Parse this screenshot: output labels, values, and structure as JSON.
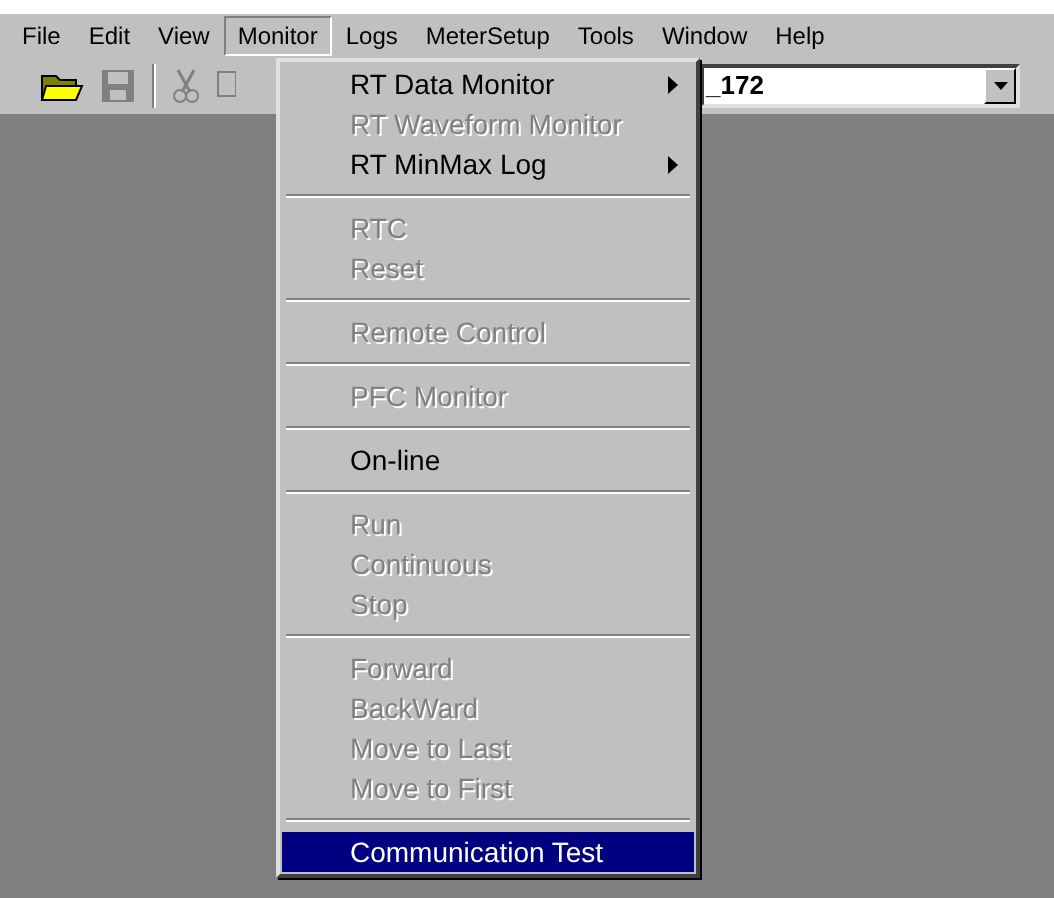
{
  "menu_bar": [
    {
      "label": "File",
      "selected": false
    },
    {
      "label": "Edit",
      "selected": false
    },
    {
      "label": "View",
      "selected": false
    },
    {
      "label": "Monitor",
      "selected": true
    },
    {
      "label": "Logs",
      "selected": false
    },
    {
      "label": "MeterSetup",
      "selected": false
    },
    {
      "label": "Tools",
      "selected": false
    },
    {
      "label": "Window",
      "selected": false
    },
    {
      "label": "Help",
      "selected": false
    }
  ],
  "toolbar": {
    "combo_value": "_172"
  },
  "menu": [
    {
      "kind": "item",
      "label": "RT Data Monitor",
      "disabled": false,
      "submenu": true,
      "selected": false
    },
    {
      "kind": "item",
      "label": "RT Waveform Monitor",
      "disabled": true,
      "submenu": false,
      "selected": false
    },
    {
      "kind": "item",
      "label": "RT MinMax Log",
      "disabled": false,
      "submenu": true,
      "selected": false
    },
    {
      "kind": "separator"
    },
    {
      "kind": "item",
      "label": "RTC",
      "disabled": true,
      "submenu": false,
      "selected": false
    },
    {
      "kind": "item",
      "label": "Reset",
      "disabled": true,
      "submenu": false,
      "selected": false
    },
    {
      "kind": "separator"
    },
    {
      "kind": "item",
      "label": "Remote Control",
      "disabled": true,
      "submenu": false,
      "selected": false
    },
    {
      "kind": "separator"
    },
    {
      "kind": "item",
      "label": "PFC Monitor",
      "disabled": true,
      "submenu": false,
      "selected": false
    },
    {
      "kind": "separator"
    },
    {
      "kind": "item",
      "label": "On-line",
      "disabled": false,
      "submenu": false,
      "selected": false
    },
    {
      "kind": "separator"
    },
    {
      "kind": "item",
      "label": "Run",
      "disabled": true,
      "submenu": false,
      "selected": false
    },
    {
      "kind": "item",
      "label": "Continuous",
      "disabled": true,
      "submenu": false,
      "selected": false
    },
    {
      "kind": "item",
      "label": "Stop",
      "disabled": true,
      "submenu": false,
      "selected": false
    },
    {
      "kind": "separator"
    },
    {
      "kind": "item",
      "label": "Forward",
      "disabled": true,
      "submenu": false,
      "selected": false
    },
    {
      "kind": "item",
      "label": "BackWard",
      "disabled": true,
      "submenu": false,
      "selected": false
    },
    {
      "kind": "item",
      "label": "Move to Last",
      "disabled": true,
      "submenu": false,
      "selected": false
    },
    {
      "kind": "item",
      "label": "Move to First",
      "disabled": true,
      "submenu": false,
      "selected": false
    },
    {
      "kind": "separator"
    },
    {
      "kind": "item",
      "label": "Communication Test",
      "disabled": false,
      "submenu": false,
      "selected": true
    }
  ]
}
